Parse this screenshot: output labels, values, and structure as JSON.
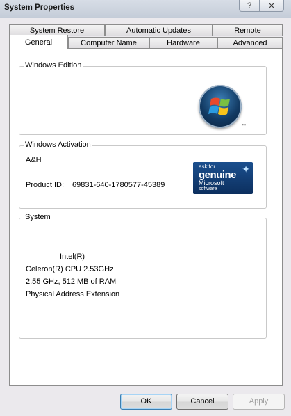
{
  "window": {
    "title": "System Properties",
    "help_label": "?",
    "close_label": "✕"
  },
  "tabs": {
    "row_back": [
      "System Restore",
      "Automatic Updates",
      "Remote"
    ],
    "row_front": [
      "General",
      "Computer Name",
      "Hardware",
      "Advanced"
    ],
    "active": "General"
  },
  "edition": {
    "title": "Windows Edition"
  },
  "activation": {
    "title": "Windows Activation",
    "owner": "A&H",
    "product_id_label": "Product ID:",
    "product_id": "69831-640-1780577-45389",
    "badge": {
      "line1": "ask for",
      "line2": "genuine",
      "line3": "Microsoft",
      "line4": "software"
    }
  },
  "system": {
    "title": "System",
    "lines": [
      "Intel(R)",
      "Celeron(R) CPU 2.53GHz",
      "2.55 GHz, 512 MB of RAM",
      "Physical Address Extension"
    ]
  },
  "buttons": {
    "ok": "OK",
    "cancel": "Cancel",
    "apply": "Apply"
  },
  "colors": {
    "window_bg": "#ebe9ed",
    "default_button_border": "#3c7fb1"
  },
  "icons": {
    "edition_logo": "windows-logo-icon",
    "activation_badge": "genuine-microsoft-icon"
  }
}
